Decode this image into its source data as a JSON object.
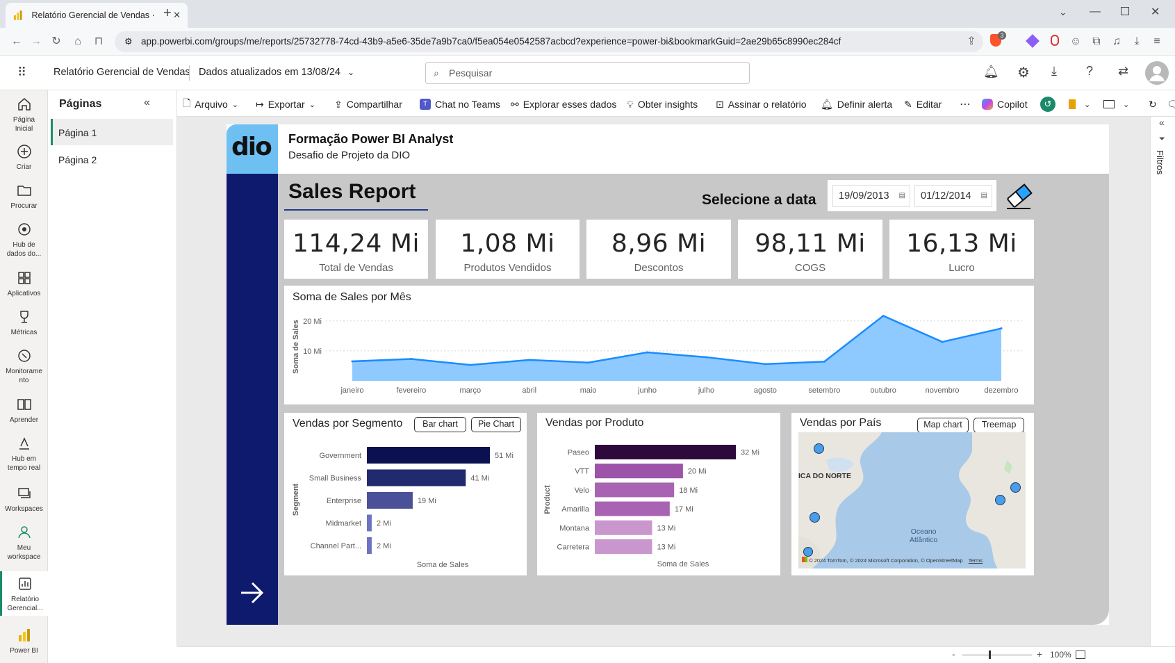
{
  "browser": {
    "tab_title": "Relatório Gerencial de Vendas ·",
    "url": "app.powerbi.com/groups/me/reports/25732778-74cd-43b9-a5e6-35de7a9b7ca0/f5ea054e0542587acbcd?experience=power-bi&bookmarkGuid=2ae29b65c8990ec284cf",
    "shield_badge": "3"
  },
  "header": {
    "report_name": "Relatório Gerencial de Vendas",
    "data_updated": "Dados atualizados em 13/08/24",
    "search_placeholder": "Pesquisar"
  },
  "rail": [
    {
      "label": "Página Inicial",
      "icon": "home-icon"
    },
    {
      "label": "Criar",
      "icon": "create-icon"
    },
    {
      "label": "Procurar",
      "icon": "browse-icon"
    },
    {
      "label": "Hub de dados do...",
      "icon": "data-hub-icon"
    },
    {
      "label": "Aplicativos",
      "icon": "apps-icon"
    },
    {
      "label": "Métricas",
      "icon": "metrics-icon"
    },
    {
      "label": "Monitoramento",
      "icon": "monitoring-icon"
    },
    {
      "label": "Aprender",
      "icon": "learn-icon"
    },
    {
      "label": "Hub em tempo real",
      "icon": "realtime-hub-icon"
    },
    {
      "label": "Workspaces",
      "icon": "workspaces-icon"
    },
    {
      "label": "Meu workspace",
      "icon": "my-workspace-icon"
    },
    {
      "label": "Relatório Gerencial...",
      "icon": "report-icon"
    },
    {
      "label": "Power BI",
      "icon": "powerbi-logo-icon"
    }
  ],
  "pages_pane": {
    "title": "Páginas",
    "pages": [
      "Página 1",
      "Página 2"
    ]
  },
  "toolbar": {
    "arquivo": "Arquivo",
    "exportar": "Exportar",
    "compartilhar": "Compartilhar",
    "chat_teams": "Chat no Teams",
    "explorar": "Explorar esses dados",
    "insights": "Obter insights",
    "assinar": "Assinar o relatório",
    "alerta": "Definir alerta",
    "editar": "Editar",
    "copilot": "Copilot"
  },
  "report": {
    "logo_text": "dio",
    "banner_title": "Formação Power BI Analyst",
    "banner_subtitle": "Desafio de Projeto da DIO",
    "page_title": "Sales Report",
    "date_label": "Selecione a data",
    "date_start": "19/09/2013",
    "date_end": "01/12/2014",
    "kpis": [
      {
        "value": "114,24 Mi",
        "label": "Total de Vendas"
      },
      {
        "value": "1,08 Mi",
        "label": "Produtos Vendidos"
      },
      {
        "value": "8,96 Mi",
        "label": "Descontos"
      },
      {
        "value": "98,11 Mi",
        "label": "COGS"
      },
      {
        "value": "16,13 Mi",
        "label": "Lucro"
      }
    ],
    "segment_buttons": [
      "Bar chart",
      "Pie Chart"
    ],
    "country_buttons": [
      "Map chart",
      "Treemap"
    ],
    "map": {
      "label_continent": "ICA DO NORTE",
      "label_ocean_1": "Oceano",
      "label_ocean_2": "Atlântico",
      "attribution": "© 2024 TomTom, © 2024 Microsoft Corporation, © OpenStreetMap",
      "terms": "Terms"
    },
    "visual_titles": {
      "country": "Vendas por País"
    }
  },
  "status": {
    "zoom": "100%"
  },
  "filters_label": "Filtros",
  "colors": {
    "navy": "#0d1a6e",
    "accent_blue": "#1a8cff",
    "area_fill": "#8ec9ff",
    "light_blue": "#6ec0f3"
  },
  "chart_data": [
    {
      "type": "area",
      "title": "Soma de Sales por Mês",
      "ylabel": "Soma de Sales",
      "categories": [
        "janeiro",
        "fevereiro",
        "março",
        "abril",
        "maio",
        "junho",
        "julho",
        "agosto",
        "setembro",
        "outubro",
        "novembro",
        "dezembro"
      ],
      "values": [
        6.5,
        7.3,
        5.3,
        7.0,
        6.1,
        9.5,
        7.9,
        5.6,
        6.4,
        21.7,
        13.0,
        17.5
      ],
      "ytick_labels": [
        "10 Mi",
        "20 Mi"
      ],
      "yticks": [
        10,
        20
      ],
      "ylim": [
        0,
        22.5
      ],
      "grid": true
    },
    {
      "type": "bar",
      "orientation": "horizontal",
      "title": "Vendas por Segmento",
      "xlabel": "Soma de Sales",
      "ylabel": "Segment",
      "categories": [
        "Government",
        "Small Business",
        "Enterprise",
        "Midmarket",
        "Channel Part..."
      ],
      "values": [
        51,
        41,
        19,
        2,
        2
      ],
      "data_labels": [
        "51 Mi",
        "41 Mi",
        "19 Mi",
        "2 Mi",
        "2 Mi"
      ],
      "colors": [
        "#0b1150",
        "#222a6e",
        "#4b5199",
        "#6c74c2",
        "#6c74c2"
      ]
    },
    {
      "type": "bar",
      "orientation": "horizontal",
      "title": "Vendas por Produto",
      "xlabel": "Soma de Sales",
      "ylabel": "Product",
      "categories": [
        "Paseo",
        "VTT",
        "Velo",
        "Amarilla",
        "Montana",
        "Carretera"
      ],
      "values": [
        32,
        20,
        18,
        17,
        13,
        13
      ],
      "data_labels": [
        "32 Mi",
        "20 Mi",
        "18 Mi",
        "17 Mi",
        "13 Mi",
        "13 Mi"
      ],
      "colors": [
        "#2e0a3c",
        "#9c53a8",
        "#a963b3",
        "#a963b3",
        "#c996ce",
        "#c996ce"
      ]
    }
  ]
}
